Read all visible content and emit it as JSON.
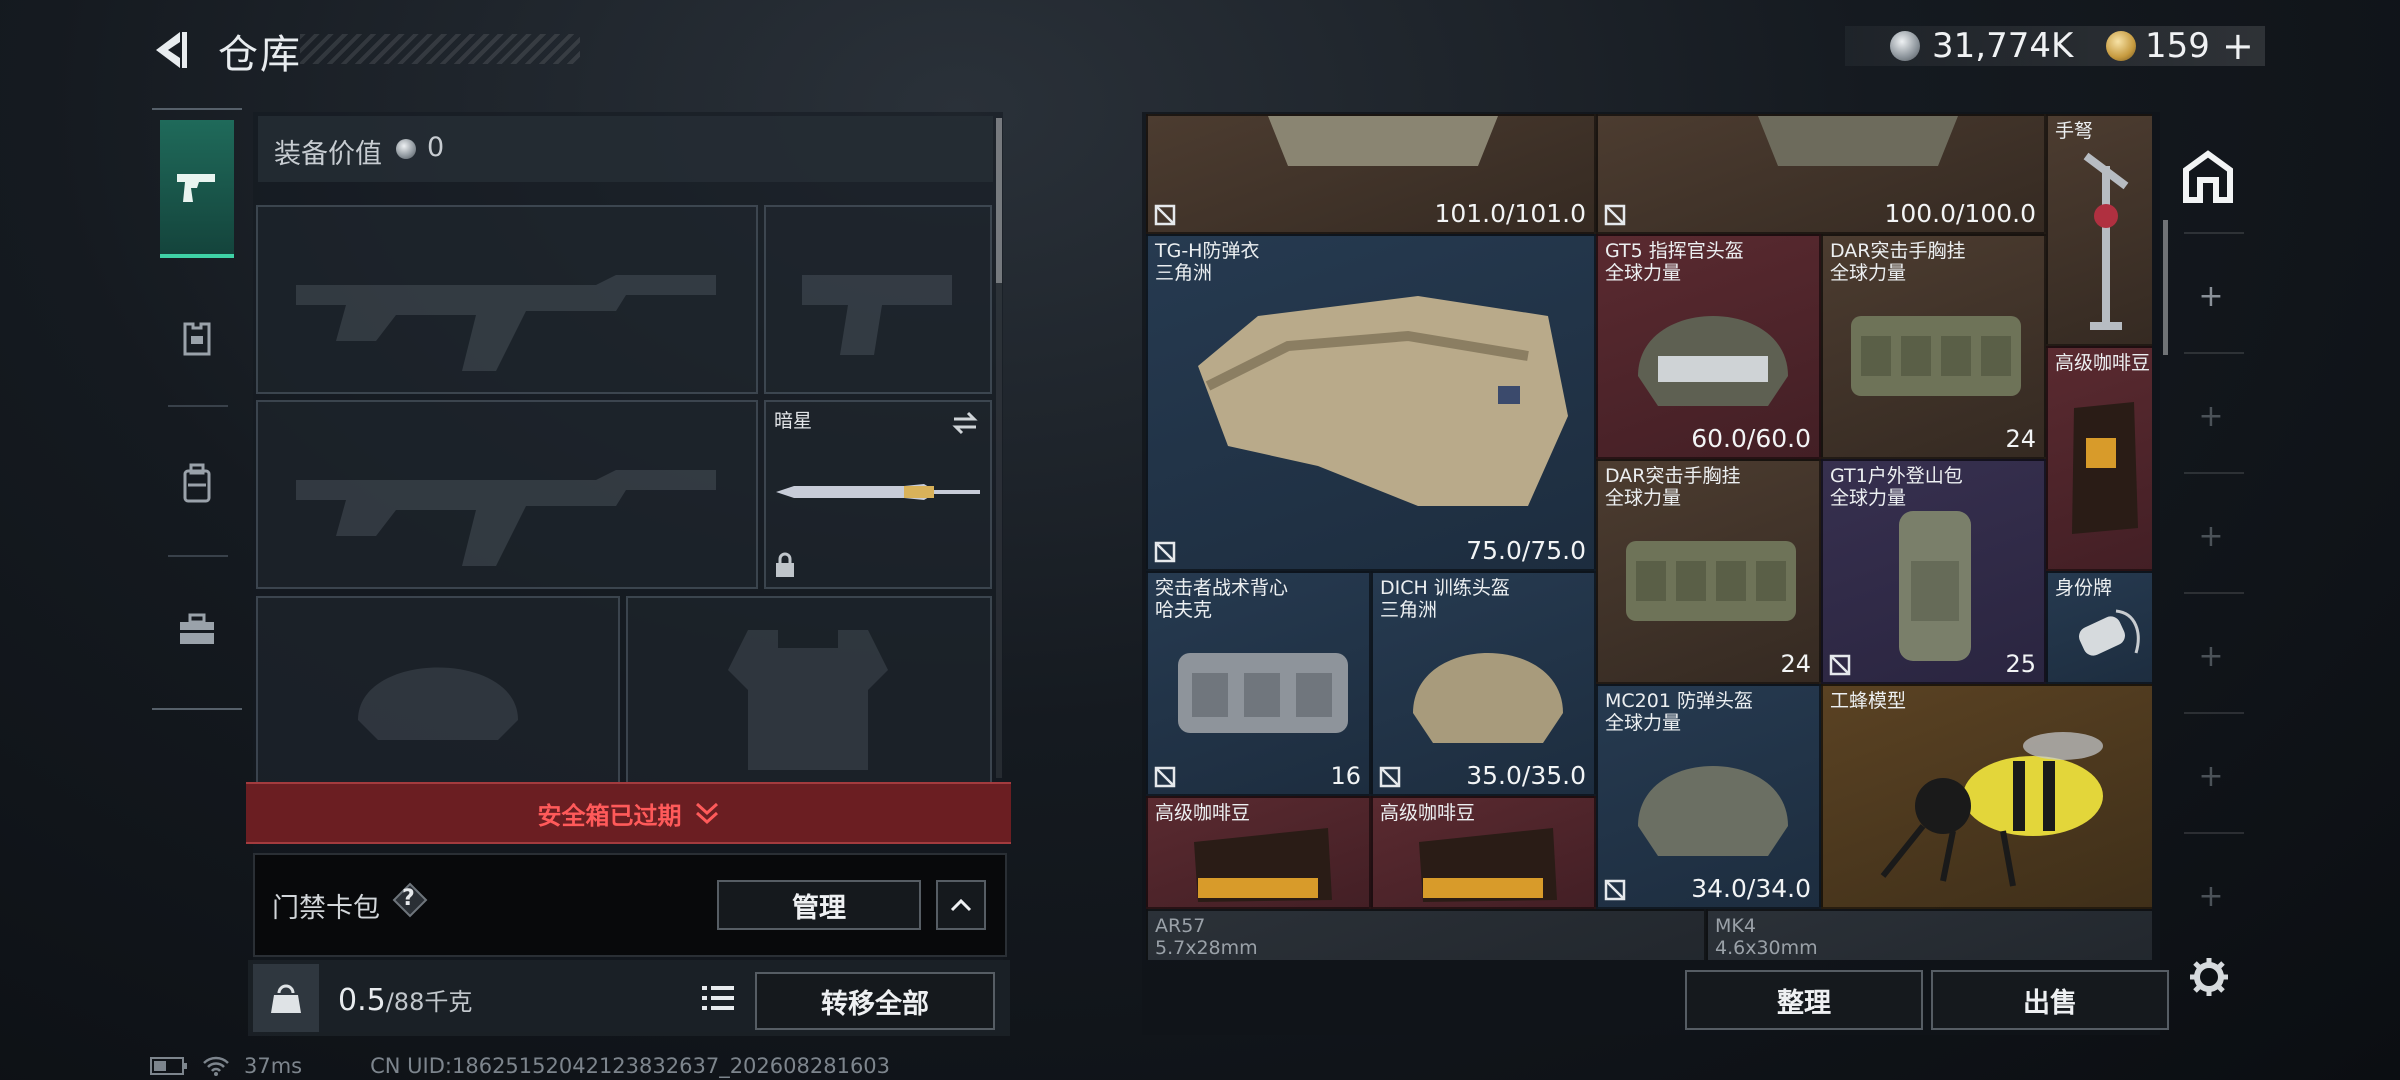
{
  "header": {
    "title": "仓库",
    "currency": [
      {
        "icon": "silver-coin-icon",
        "value": "31,774K"
      },
      {
        "icon": "gold-coin-icon",
        "value": "159"
      }
    ],
    "add_symbol": "+"
  },
  "left_tabs": [
    {
      "icon": "pistol-icon",
      "active": true
    },
    {
      "icon": "vest-icon",
      "active": false
    },
    {
      "icon": "backpack-icon",
      "active": false
    },
    {
      "icon": "briefcase-icon",
      "active": false
    }
  ],
  "equipment": {
    "value_label": "装备价值",
    "value": "0",
    "melee_name": "暗星"
  },
  "safe_box": {
    "expired_text": "安全箱已过期"
  },
  "card_pack": {
    "label": "门禁卡包",
    "help": "?",
    "manage_label": "管理"
  },
  "footer_left": {
    "weight_current": "0.5",
    "weight_max": "/88千克",
    "transfer_all_label": "转移全部"
  },
  "status": {
    "ping": "37ms",
    "uid": "CN UID:18625152042123832637_202608281603"
  },
  "stash_items": [
    {
      "name": "",
      "sub": "",
      "durability": "101.0/101.0"
    },
    {
      "name": "",
      "sub": "",
      "durability": "100.0/100.0"
    },
    {
      "name": "手弩",
      "sub": ""
    },
    {
      "name": "TG-H防弹衣",
      "sub": "三角洲",
      "durability": "75.0/75.0"
    },
    {
      "name": "GT5 指挥官头盔",
      "sub": "全球力量",
      "durability": "60.0/60.0"
    },
    {
      "name": "DAR突击手胸挂",
      "sub": "全球力量",
      "count": "24"
    },
    {
      "name": "高级咖啡豆",
      "sub": ""
    },
    {
      "name": "DAR突击手胸挂",
      "sub": "全球力量",
      "count": "24"
    },
    {
      "name": "GT1户外登山包",
      "sub": "全球力量",
      "count": "25"
    },
    {
      "name": "身份牌",
      "sub": ""
    },
    {
      "name": "突击者战术背心",
      "sub": "哈夫克",
      "count": "16"
    },
    {
      "name": "DICH 训练头盔",
      "sub": "三角洲",
      "durability": "35.0/35.0"
    },
    {
      "name": "MC201 防弹头盔",
      "sub": "全球力量",
      "durability": "34.0/34.0"
    },
    {
      "name": "工蜂模型",
      "sub": ""
    },
    {
      "name": "高级咖啡豆",
      "sub": ""
    },
    {
      "name": "高级咖啡豆",
      "sub": ""
    },
    {
      "name": "AR57",
      "sub": "5.7x28mm"
    },
    {
      "name": "MK4",
      "sub": "4.6x30mm"
    }
  ],
  "stash_actions": {
    "organize_label": "整理",
    "sell_label": "出售"
  },
  "colors": {
    "accent_green": "#3fd2a6",
    "expired_red": "#ff5a5a"
  }
}
